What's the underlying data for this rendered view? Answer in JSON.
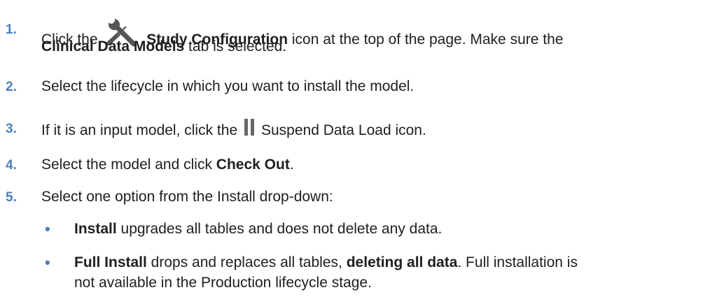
{
  "steps": [
    {
      "number": "1.",
      "line1_pre": "Click the",
      "icon": "study-configuration-icon",
      "line1_bold": "Study Configuration",
      "line1_post": " icon at the top of the page. Make sure the",
      "line2_bold": "Clinical Data Models",
      "line2_post": " tab is selected."
    },
    {
      "number": "2.",
      "text": "Select the lifecycle in which you want to install the model."
    },
    {
      "number": "3.",
      "pre": "If it is an input model, click the",
      "icon": "pause-icon",
      "post": "Suspend Data Load icon."
    },
    {
      "number": "4.",
      "pre": "Select the model and click ",
      "bold": "Check Out",
      "post": "."
    },
    {
      "number": "5.",
      "text": "Select one option from the Install drop-down:"
    }
  ],
  "options": [
    {
      "bullet": "•",
      "bold": "Install",
      "post": " upgrades all tables and does not delete any data."
    },
    {
      "bullet": "•",
      "bold1": "Full Install",
      "mid": " drops and replaces all tables, ",
      "bold2": "deleting all data",
      "post": ". Full installation is",
      "line2": "not available in the Production lifecycle stage."
    }
  ],
  "colors": {
    "accent": "#4a7fbf",
    "text": "#202020",
    "icon": "#555555"
  }
}
